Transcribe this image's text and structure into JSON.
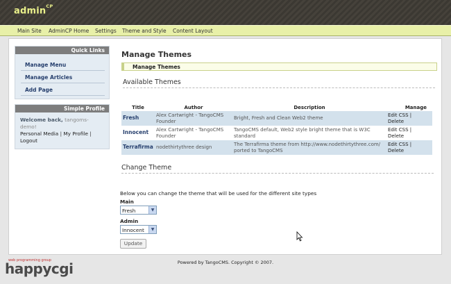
{
  "header": {
    "logo": "admin",
    "logo_sup": "CP"
  },
  "nav": [
    "Main Site",
    "AdminCP Home",
    "Settings",
    "Theme and Style",
    "Content Layout"
  ],
  "sidebar": {
    "quick_links_title": "Quick Links",
    "links": [
      "Manage Menu",
      "Manage Articles",
      "Add Page"
    ],
    "profile_title": "Simple Profile",
    "welcome": "Welcome back,",
    "username": "tangoms-demo!",
    "personal_media": "Personal Media",
    "sep": "|",
    "my_profile": "My Profile",
    "logout": "Logout"
  },
  "main": {
    "title": "Manage Themes",
    "breadcrumb": "Manage Themes",
    "available_title": "Available Themes",
    "columns": [
      "Title",
      "Author",
      "Description",
      "Manage"
    ],
    "rows": [
      {
        "title": "Fresh",
        "author": "Alex Cartwright - TangoCMS Founder",
        "description": "Bright, Fresh and Clean Web2 theme",
        "edit": "Edit CSS",
        "delete": "Delete"
      },
      {
        "title": "Innocent",
        "author": "Alex Cartwright - TangoCMS Founder",
        "description": "TangoCMS default, Web2 style bright theme that is W3C standard",
        "edit": "Edit CSS",
        "delete": "Delete"
      },
      {
        "title": "Terrafirma",
        "author": "nodethirtythree design",
        "description": "The Terrafirma theme from http://www.nodethirtythree.com/ ported to TangoCMS",
        "edit": "Edit CSS",
        "delete": "Delete"
      }
    ],
    "manage_sep": "|",
    "change_title": "Change Theme",
    "change_desc": "Below you can change the theme that will be used for the different site types",
    "main_label": "Main",
    "main_value": "Fresh",
    "admin_label": "Admin",
    "admin_value": "Innocent",
    "update_label": "Update"
  },
  "footer": "Powered by TangoCMS. Copyright © 2007.",
  "watermark": {
    "small": "web programming group",
    "big": "happycgi"
  }
}
